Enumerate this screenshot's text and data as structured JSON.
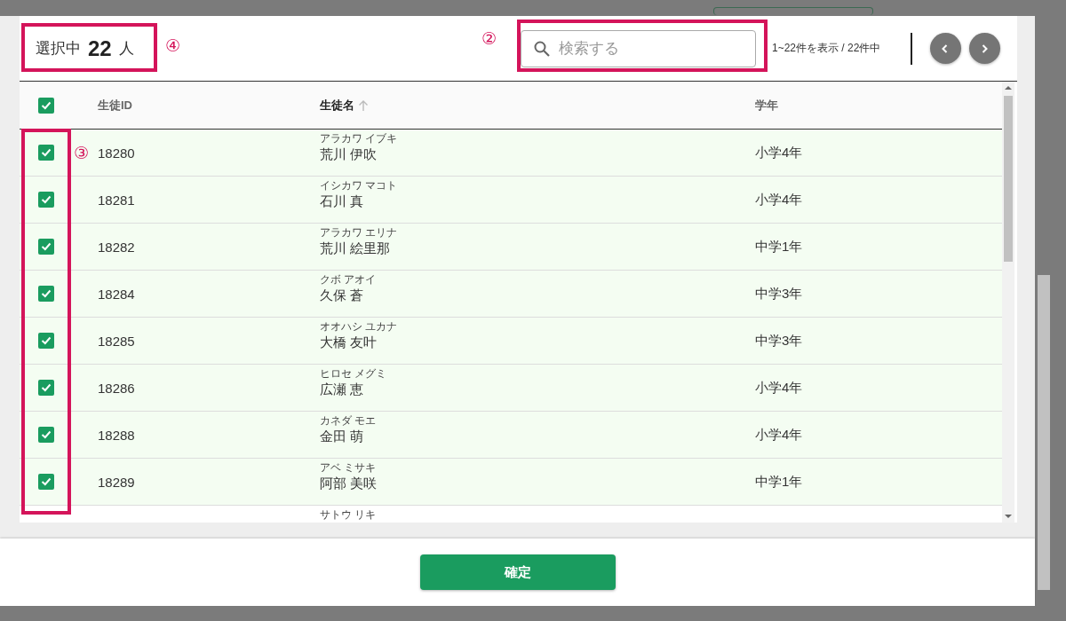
{
  "selection": {
    "label": "選択中",
    "count": "22",
    "unit": "人"
  },
  "search": {
    "placeholder": "検索する"
  },
  "paging": {
    "text": "1~22件を表示 / 22件中"
  },
  "table": {
    "all_checked": true,
    "columns": [
      {
        "label": "生徒ID",
        "sorted": false
      },
      {
        "label": "生徒名",
        "sorted": true
      },
      {
        "label": "学年",
        "sorted": false
      }
    ],
    "rows": [
      {
        "checked": true,
        "id": "18280",
        "kana": "アラカワ イブキ",
        "name": "荒川 伊吹",
        "grade": "小学4年"
      },
      {
        "checked": true,
        "id": "18281",
        "kana": "イシカワ マコト",
        "name": "石川 真",
        "grade": "小学4年"
      },
      {
        "checked": true,
        "id": "18282",
        "kana": "アラカワ エリナ",
        "name": "荒川 絵里那",
        "grade": "中学1年"
      },
      {
        "checked": true,
        "id": "18284",
        "kana": "クボ アオイ",
        "name": "久保 蒼",
        "grade": "中学3年"
      },
      {
        "checked": true,
        "id": "18285",
        "kana": "オオハシ ユカナ",
        "name": "大橋 友叶",
        "grade": "中学3年"
      },
      {
        "checked": true,
        "id": "18286",
        "kana": "ヒロセ メグミ",
        "name": "広瀬 恵",
        "grade": "小学4年"
      },
      {
        "checked": true,
        "id": "18288",
        "kana": "カネダ モエ",
        "name": "金田 萌",
        "grade": "小学4年"
      },
      {
        "checked": true,
        "id": "18289",
        "kana": "アベ ミサキ",
        "name": "阿部 美咲",
        "grade": "中学1年"
      },
      {
        "kana": "サトウ リキ"
      }
    ]
  },
  "confirm_button": "確定",
  "annotations": [
    {
      "kind": "search",
      "number": "②"
    },
    {
      "kind": "checkboxes",
      "number": "③"
    },
    {
      "kind": "selection",
      "number": "④"
    }
  ]
}
